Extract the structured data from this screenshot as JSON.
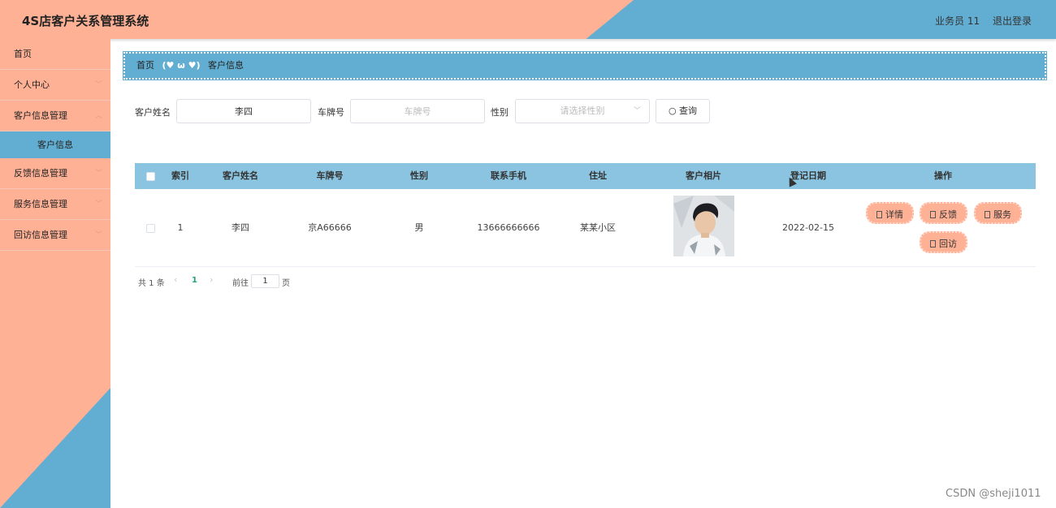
{
  "header": {
    "title": "4S店客户关系管理系统",
    "user": "业务员 11",
    "logout": "退出登录"
  },
  "sidebar": {
    "items": [
      {
        "label": "首页"
      },
      {
        "label": "个人中心"
      },
      {
        "label": "客户信息管理"
      },
      {
        "label": "客户信息"
      },
      {
        "label": "反馈信息管理"
      },
      {
        "label": "服务信息管理"
      },
      {
        "label": "回访信息管理"
      }
    ]
  },
  "breadcrumb": {
    "home": "首页",
    "separator": "(♥ ω ♥)",
    "current": "客户信息"
  },
  "search": {
    "name_label": "客户姓名",
    "name_value": "李四",
    "plate_label": "车牌号",
    "plate_placeholder": "车牌号",
    "gender_label": "性别",
    "gender_placeholder": "请选择性别",
    "button": "查询"
  },
  "table": {
    "headers": [
      "索引",
      "客户姓名",
      "车牌号",
      "性别",
      "联系手机",
      "住址",
      "客户相片",
      "登记日期",
      "操作"
    ],
    "rows": [
      {
        "index": "1",
        "name": "李四",
        "plate": "京A66666",
        "gender": "男",
        "phone": "13666666666",
        "address": "某某小区",
        "date": "2022-02-15"
      }
    ],
    "actions": [
      "详情",
      "反馈",
      "服务",
      "回访"
    ]
  },
  "pagination": {
    "total": "共 1 条",
    "current": "1",
    "goto": "前往",
    "page_input": "1",
    "page_suffix": "页"
  },
  "watermark": "CSDN @sheji1011",
  "colors": {
    "salmon": "#ffb196",
    "blue": "#62aed2",
    "header_row": "#8bc4e0"
  }
}
